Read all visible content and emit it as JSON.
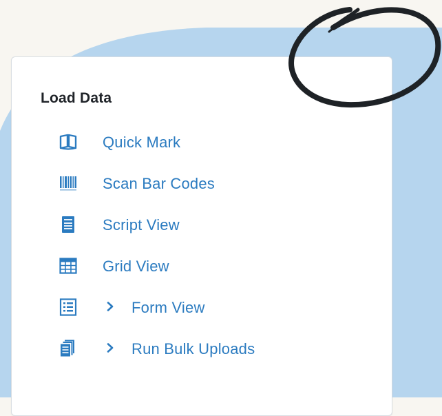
{
  "panel": {
    "title": "Load Data",
    "items": [
      {
        "label": "Quick Mark",
        "icon": "book-open-icon",
        "expandable": false
      },
      {
        "label": "Scan Bar Codes",
        "icon": "barcode-icon",
        "expandable": false
      },
      {
        "label": "Script View",
        "icon": "script-document-icon",
        "expandable": false
      },
      {
        "label": "Grid View",
        "icon": "grid-table-icon",
        "expandable": false
      },
      {
        "label": "Form View",
        "icon": "form-list-icon",
        "expandable": true
      },
      {
        "label": "Run Bulk Uploads",
        "icon": "stacked-documents-icon",
        "expandable": true
      }
    ]
  },
  "colors": {
    "page_background": "#f8f6f1",
    "blob": "#b6d5ee",
    "accent": "#2b7bc0",
    "title": "#1f2328",
    "scribble": "#1e2226"
  }
}
